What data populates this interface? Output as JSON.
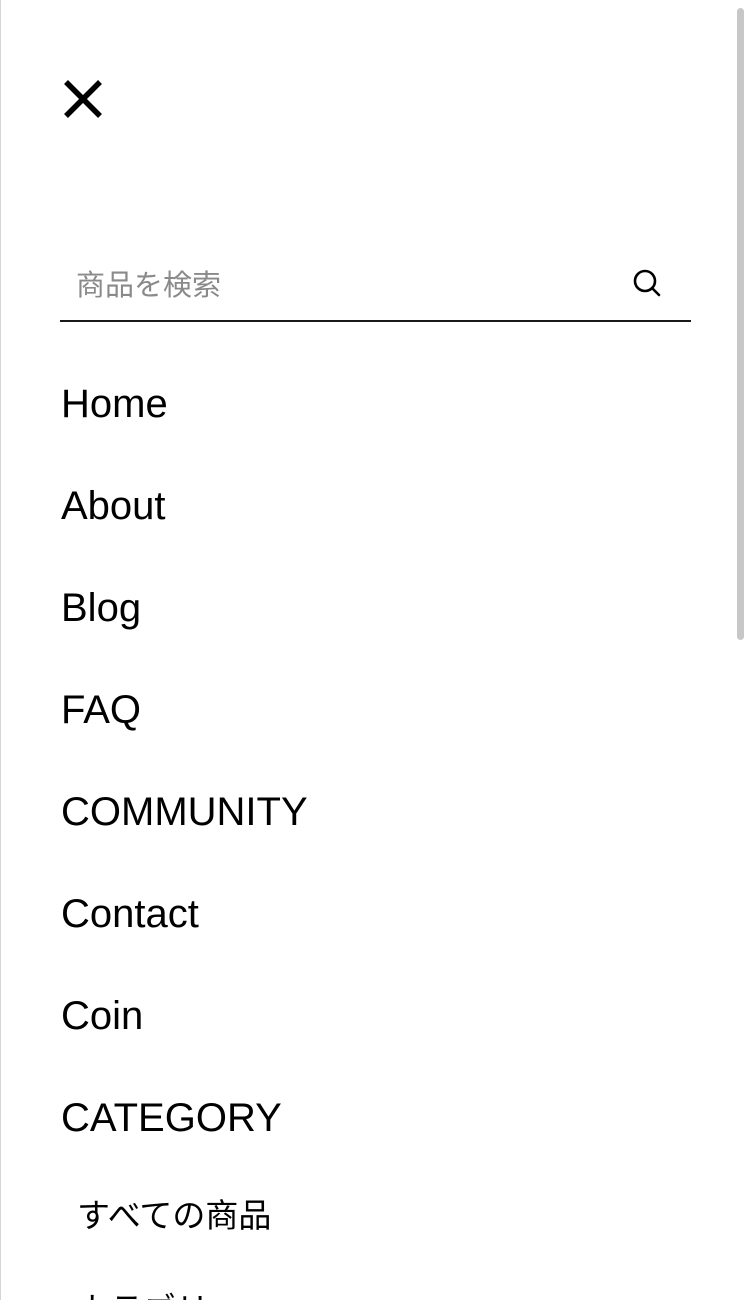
{
  "search": {
    "placeholder": "商品を検索",
    "value": ""
  },
  "nav": {
    "items": [
      {
        "label": "Home"
      },
      {
        "label": "About"
      },
      {
        "label": "Blog"
      },
      {
        "label": "FAQ"
      },
      {
        "label": "COMMUNITY"
      },
      {
        "label": "Contact"
      },
      {
        "label": "Coin"
      },
      {
        "label": "CATEGORY"
      }
    ],
    "sub_items": [
      {
        "label": "すべての商品"
      },
      {
        "label": "カテゴリー"
      }
    ]
  },
  "icons": {
    "close": "close-icon",
    "search": "search-icon"
  },
  "colors": {
    "text": "#000000",
    "placeholder": "#8a8a8a",
    "divider": "#1a1a1a",
    "scrollbar": "#c7c7c7"
  }
}
